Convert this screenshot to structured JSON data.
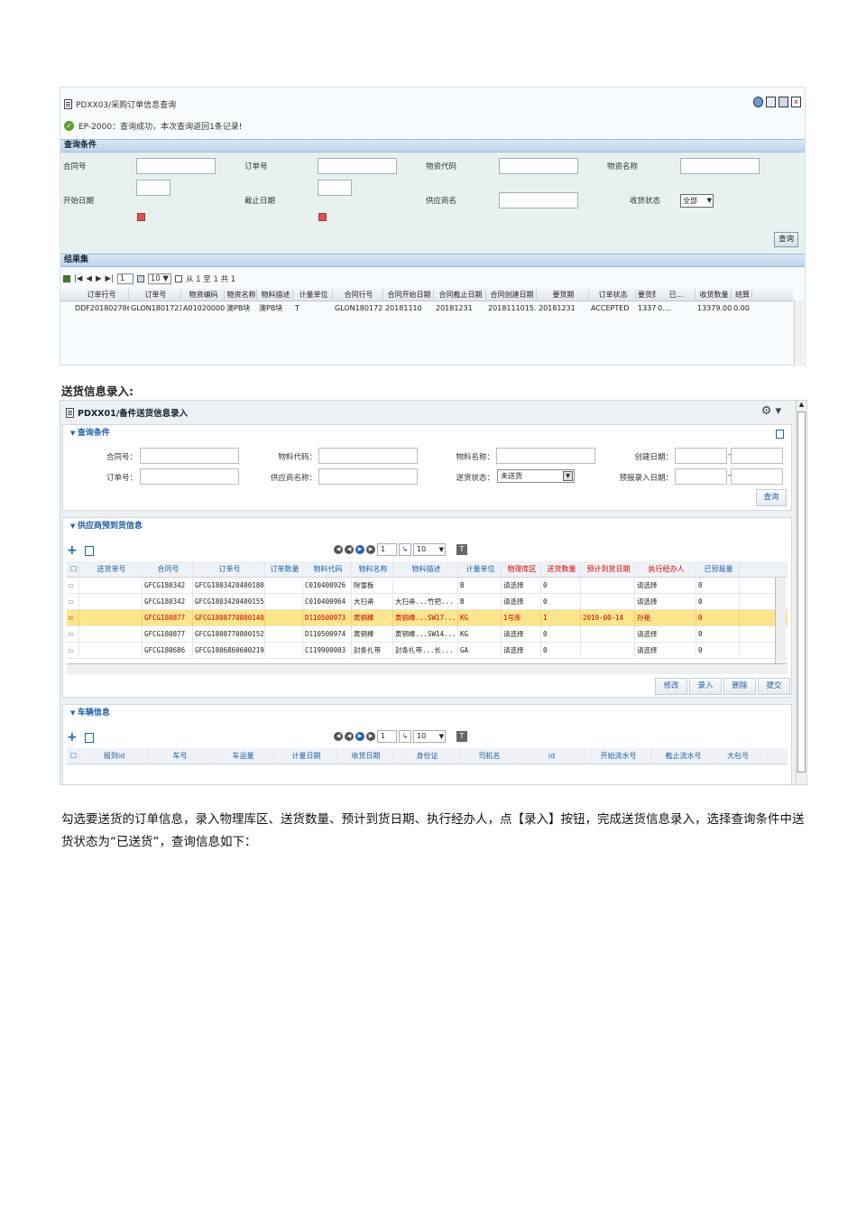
{
  "shot1": {
    "title": "PDXX03/采购订单信息查询",
    "message": "EP-2000：查询成功，本次查询返回1条记录!",
    "query_section": "查询条件",
    "fields": {
      "contract_no": "合同号",
      "order_no": "订单号",
      "material_code": "物资代码",
      "material_name": "物资名称",
      "start_date": "开始日期",
      "end_date": "截止日期",
      "supplier_name": "供应商名",
      "receipt_status": "收货状态",
      "receipt_status_value": "全部"
    },
    "query_button": "查询",
    "result_section": "结果集",
    "pager": {
      "page": "1",
      "page_size": "10",
      "summary": "从 1 至 1 共 1"
    },
    "columns": [
      "订单行号",
      "订单号",
      "物资编码",
      "物资名称",
      "物料描述",
      "计量单位",
      "合同行号",
      "合同开始日期",
      "合同截止日期",
      "合同创建日期",
      "要货期",
      "订单状态",
      "要货数量",
      "已...",
      "收货数量",
      "结算"
    ],
    "rows": [
      [
        "DDF2018027869",
        "GLON1801721...",
        "A010200002",
        "澳PB块",
        "澳PB块",
        "T",
        "GLON180172...",
        "20181110",
        "20181231",
        "2018111015...",
        "20181231",
        "ACCEPTED",
        "13379.00...",
        "0....",
        "13379.0000",
        "0.00"
      ]
    ]
  },
  "heading": "送货信息录入:",
  "shot2": {
    "title": "PDXX01/备件送货信息录入",
    "query_section": "查询条件",
    "fields": {
      "contract_no": "合同号：",
      "material_code": "物料代码：",
      "material_name": "物料名称：",
      "create_date": "创建日期：",
      "order_no": "订单号：",
      "supplier_name": "供应商名称：",
      "delivery_status": "送货状态：",
      "delivery_status_value": "未送货",
      "forecast_date": "预报录入日期："
    },
    "date_sep": "-",
    "query_button": "查询",
    "arrival_section": "供应商预到货信息",
    "pager": {
      "page": "1",
      "page_size": "10"
    },
    "columns": [
      "送货单号",
      "合同号",
      "订单号",
      "订单数量",
      "物料代码",
      "物料名称",
      "物料描述",
      "计量单位",
      "物理库区",
      "送货数量",
      "预计到货日期",
      "执行经办人",
      "已预报量"
    ],
    "rows": [
      {
        "checked": "",
        "cells": [
          "",
          "GFCG180342",
          "GFCG1803420400180",
          "",
          "C010400926",
          "除雪板",
          "",
          "B",
          "请选择",
          "0",
          "",
          "请选择",
          "0"
        ]
      },
      {
        "checked": "",
        "cells": [
          "",
          "GFCG180342",
          "GFCG1803420400155",
          "",
          "C010400964",
          "大扫帚",
          "大扫帚...竹把...",
          "B",
          "请选择",
          "0",
          "",
          "请选择",
          "0"
        ]
      },
      {
        "checked": "✓",
        "cells": [
          "",
          "GFCG180877",
          "GFCG1808770800140",
          "",
          "D110500973",
          "黄铜棒",
          "黄铜棒...SW17...",
          "KG",
          "1号库",
          "1",
          "2019-00-14",
          "孙艳",
          "0"
        ]
      },
      {
        "checked": "",
        "cells": [
          "",
          "GFCG180877",
          "GFCG1808770800152",
          "",
          "D110500974",
          "黄铜棒",
          "黄铜棒...SW14...",
          "KG",
          "请选择",
          "0",
          "",
          "请选择",
          "0"
        ]
      },
      {
        "checked": "",
        "cells": [
          "",
          "GFCG180686",
          "GFCG1806860600219750",
          "",
          "C119900003",
          "封条扎带",
          "封条扎带...长...",
          "GA",
          "请选择",
          "0",
          "",
          "请选择",
          "0"
        ]
      }
    ],
    "actions": [
      "修改",
      "录入",
      "删除",
      "提交"
    ],
    "vehicle_section": "车辆信息",
    "vehicle_columns": [
      "报到id",
      "车号",
      "车运量",
      "计量日期",
      "收货日期",
      "身份证",
      "司机名",
      "id",
      "开始流水号",
      "截止流水号",
      "大包号"
    ]
  },
  "paragraph": "勾选要送货的订单信息，录入物理库区、送货数量、预计到货日期、执行经办人，点【录入】按钮，完成送货信息录入，选择查询条件中送货状态为“已送货”，查询信息如下："
}
